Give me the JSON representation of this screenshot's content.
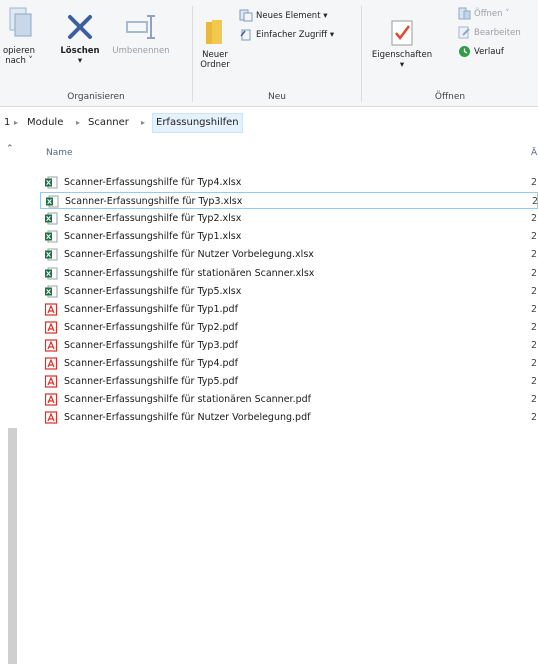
{
  "ribbon": {
    "organize": {
      "group_label": "Organisieren",
      "copy_label_1": "opieren",
      "copy_label_2": "nach ˅",
      "delete_label": "Löschen",
      "delete_arrow": "▾",
      "rename_label": "Umbenennen"
    },
    "new": {
      "group_label": "Neu",
      "new_folder_label_1": "Neuer",
      "new_folder_label_2": "Ordner",
      "new_item_label": "Neues Element ▾",
      "easy_access_label": "Einfacher Zugriff ▾"
    },
    "open": {
      "group_label": "Öffnen",
      "properties_label": "Eigenschaften",
      "properties_arrow": "▾",
      "open_label": "Öffnen ˅",
      "edit_label": "Bearbeiten",
      "history_label": "Verlauf"
    }
  },
  "breadcrumb": {
    "lead": "1",
    "items": [
      "Module",
      "Scanner",
      "Erfassungshilfen"
    ]
  },
  "columns": {
    "name": "Name",
    "date_abbrev": "Ä"
  },
  "files": [
    {
      "name": "Scanner-Erfassungshilfe für Typ4.xlsx",
      "type": "xlsx",
      "date": "2",
      "selected": false
    },
    {
      "name": "Scanner-Erfassungshilfe für Typ3.xlsx",
      "type": "xlsx",
      "date": "2",
      "selected": true
    },
    {
      "name": "Scanner-Erfassungshilfe für Typ2.xlsx",
      "type": "xlsx",
      "date": "2",
      "selected": false
    },
    {
      "name": "Scanner-Erfassungshilfe für Typ1.xlsx",
      "type": "xlsx",
      "date": "2",
      "selected": false
    },
    {
      "name": "Scanner-Erfassungshilfe für Nutzer Vorbelegung.xlsx",
      "type": "xlsx",
      "date": "2",
      "selected": false
    },
    {
      "name": "Scanner-Erfassungshilfe für stationären Scanner.xlsx",
      "type": "xlsx",
      "date": "2",
      "selected": false
    },
    {
      "name": "Scanner-Erfassungshilfe für Typ5.xlsx",
      "type": "xlsx",
      "date": "2",
      "selected": false
    },
    {
      "name": "Scanner-Erfassungshilfe für Typ1.pdf",
      "type": "pdf",
      "date": "2",
      "selected": false
    },
    {
      "name": "Scanner-Erfassungshilfe für Typ2.pdf",
      "type": "pdf",
      "date": "2",
      "selected": false
    },
    {
      "name": "Scanner-Erfassungshilfe für Typ3.pdf",
      "type": "pdf",
      "date": "2",
      "selected": false
    },
    {
      "name": "Scanner-Erfassungshilfe für Typ4.pdf",
      "type": "pdf",
      "date": "2",
      "selected": false
    },
    {
      "name": "Scanner-Erfassungshilfe für Typ5.pdf",
      "type": "pdf",
      "date": "2",
      "selected": false
    },
    {
      "name": "Scanner-Erfassungshilfe für stationären Scanner.pdf",
      "type": "pdf",
      "date": "2",
      "selected": false
    },
    {
      "name": "Scanner-Erfassungshilfe für Nutzer Vorbelegung.pdf",
      "type": "pdf",
      "date": "2",
      "selected": false
    }
  ],
  "icons": {
    "xlsx": "excel-icon",
    "pdf": "pdf-icon"
  },
  "colors": {
    "excel_green": "#1e7145",
    "pdf_red": "#d9302a",
    "selection_border": "#99c9ef",
    "folder_yellow": "#f2c94c"
  }
}
